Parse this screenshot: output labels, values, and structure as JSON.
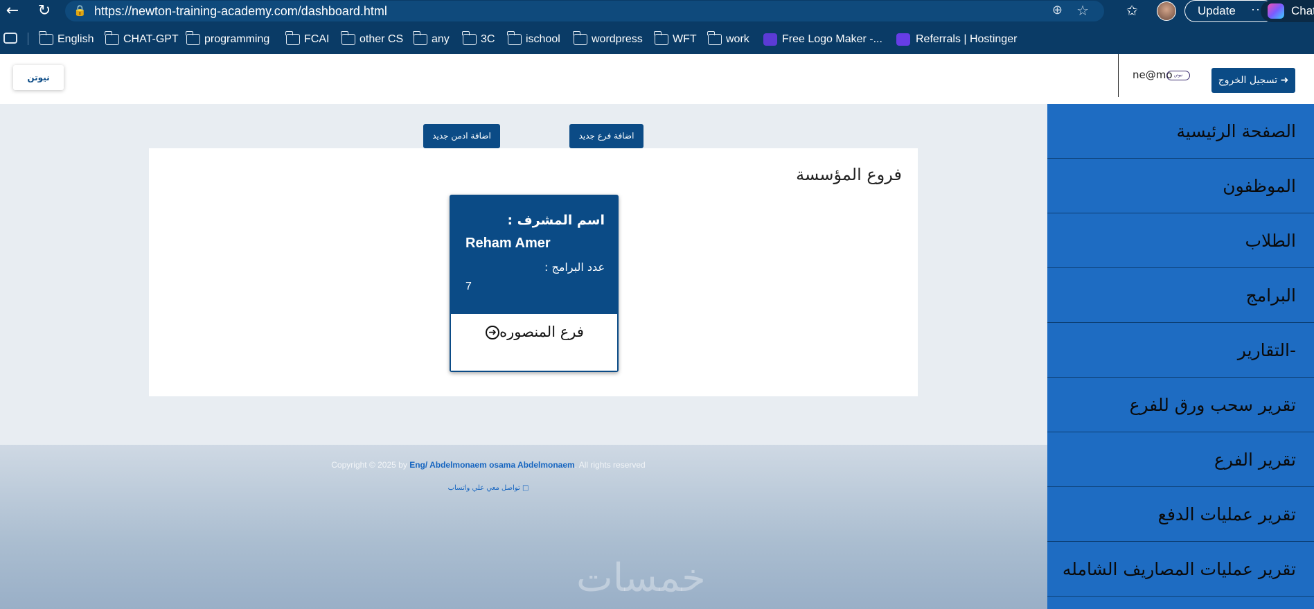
{
  "browser": {
    "url": "https://newton-training-academy.com/dashboard.html",
    "update_label": "Update",
    "chat_label": "Chat",
    "bookmarks": [
      {
        "label": "English",
        "kind": "folder"
      },
      {
        "label": "CHAT-GPT",
        "kind": "folder"
      },
      {
        "label": "programming",
        "kind": "folder"
      },
      {
        "label": "FCAI",
        "kind": "folder"
      },
      {
        "label": "other CS",
        "kind": "folder"
      },
      {
        "label": "any",
        "kind": "folder"
      },
      {
        "label": "3C",
        "kind": "folder"
      },
      {
        "label": "ischool",
        "kind": "folder"
      },
      {
        "label": "wordpress",
        "kind": "folder"
      },
      {
        "label": "WFT",
        "kind": "folder"
      },
      {
        "label": "work",
        "kind": "folder"
      },
      {
        "label": "Free Logo Maker -...",
        "kind": "site",
        "color": "#5b3bd6"
      },
      {
        "label": "Referrals | Hostinger",
        "kind": "site",
        "color": "#673de6"
      }
    ]
  },
  "header": {
    "logo_text": "نيوتن",
    "logout_label": "تسجيل الخروج",
    "user_email": "ne@mo",
    "user_badge": "نيوتن"
  },
  "sidebar": {
    "items": [
      "الصفحة الرئيسية",
      "الموظفون",
      "الطلاب",
      "البرامج",
      "-التقارير",
      "تقرير سحب ورق للفرع",
      "تقرير الفرع",
      "تقرير عمليات الدفع",
      "تقرير عمليات المصاريف الشامله"
    ]
  },
  "main": {
    "add_branch_label": "اضافة فرع جديد",
    "add_admin_label": "اضافة ادمن جديد",
    "section_title": "فروع المؤسسة",
    "branch": {
      "supervisor_label": "اسم المشرف :",
      "supervisor_name": "Reham Amer",
      "programs_label": "عدد البرامج :",
      "programs_count": "7",
      "branch_name": "فرع المنصوره"
    }
  },
  "footer": {
    "copyright_prefix": "Copyright © 2025 by",
    "author": "Eng/ Abdelmonaem osama Abdelmonaem",
    "rights": ". All rights reserved",
    "whatsapp_label": "تواصل معي علي واتساب",
    "watermark": "خمسات"
  },
  "colors": {
    "primary": "#0b4b86",
    "sidebar": "#1e6cc2",
    "chrome": "#0a3b66"
  }
}
